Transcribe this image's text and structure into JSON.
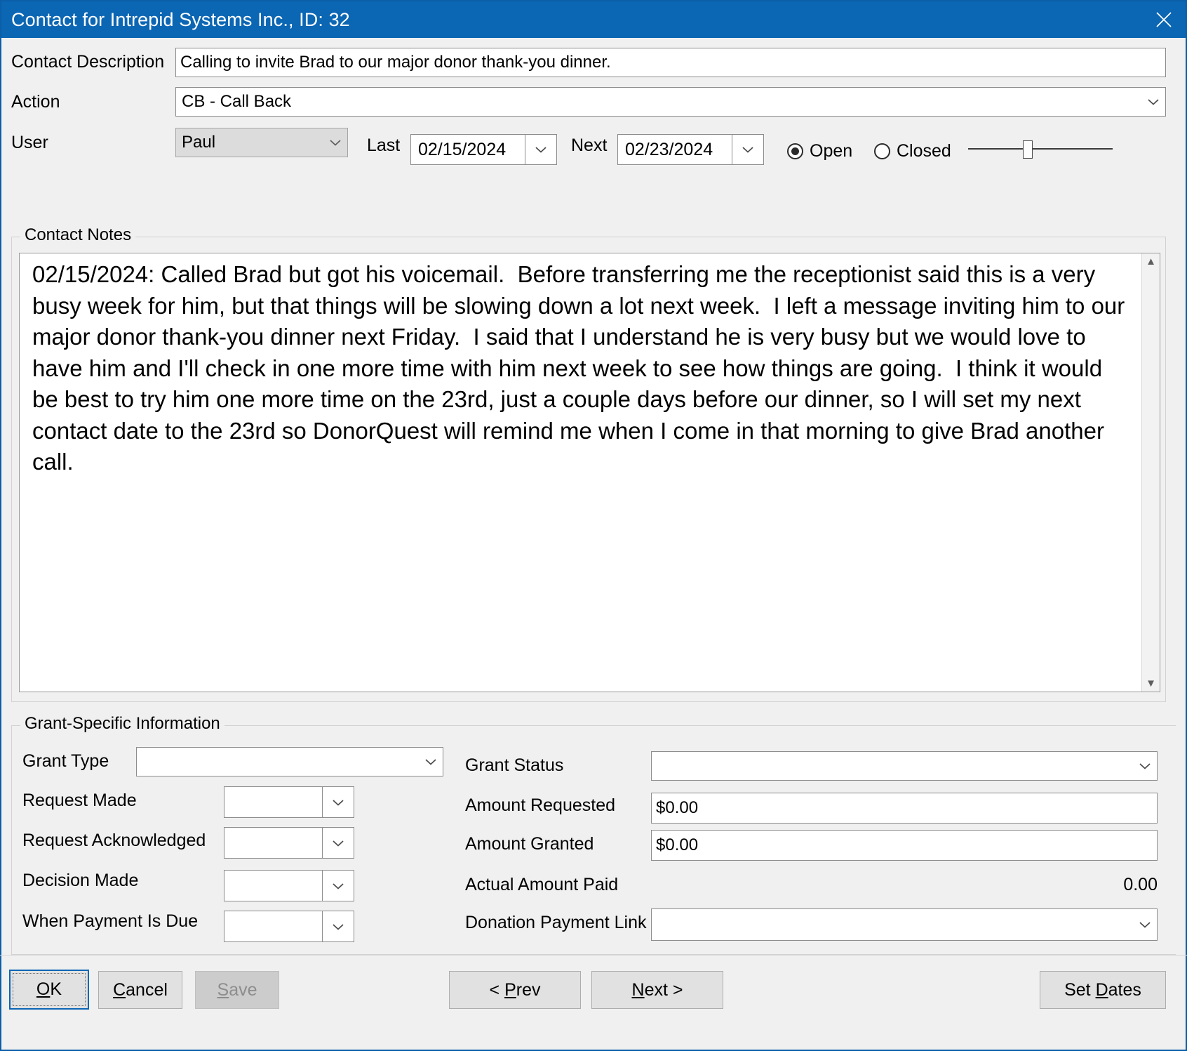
{
  "window": {
    "title": "Contact for Intrepid Systems Inc., ID: 32",
    "close_label": "✕",
    "accent_color": "#0b66b4"
  },
  "form": {
    "contact_description": {
      "label": "Contact Description",
      "value": "Calling to invite Brad to our major donor thank-you dinner.",
      "placeholder": ""
    },
    "action": {
      "label": "Action",
      "value": "CB - Call Back"
    },
    "user": {
      "label": "User",
      "value": "Paul"
    },
    "last": {
      "label": "Last",
      "value": "02/15/2024"
    },
    "next": {
      "label": "Next",
      "value": "02/23/2024"
    },
    "status": {
      "open_label": "Open",
      "closed_label": "Closed",
      "selected": "Open"
    }
  },
  "notes": {
    "legend": "Contact Notes",
    "value": "02/15/2024: Called Brad but got his voicemail.  Before transferring me the receptionist said this is a very busy week for him, but that things will be slowing down a lot next week.  I left a message inviting him to our major donor thank-you dinner next Friday.  I said that I understand he is very busy but we would love to have him and I'll check in one more time with him next week to see how things are going.  I think it would be best to try him one more time on the 23rd, just a couple days before our dinner, so I will set my next contact date to the 23rd so DonorQuest will remind me when I come in that morning to give Brad another call."
  },
  "grant": {
    "legend": "Grant-Specific Information",
    "grant_type": {
      "label": "Grant Type",
      "value": ""
    },
    "request_made": {
      "label": "Request Made",
      "value": ""
    },
    "request_acknowledged": {
      "label": "Request Acknowledged",
      "value": ""
    },
    "decision_made": {
      "label": "Decision Made",
      "value": ""
    },
    "when_payment_due": {
      "label": "When Payment Is Due",
      "value": ""
    },
    "grant_status": {
      "label": "Grant Status",
      "value": ""
    },
    "amount_requested": {
      "label": "Amount Requested",
      "value": "$0.00"
    },
    "amount_granted": {
      "label": "Amount Granted",
      "value": "$0.00"
    },
    "actual_amount_paid": {
      "label": "Actual Amount Paid",
      "value": "0.00"
    },
    "donation_payment_link": {
      "label": "Donation Payment Link",
      "value": ""
    }
  },
  "buttons": {
    "ok": "OK",
    "cancel": "Cancel",
    "save": "Save",
    "prev": "< Prev",
    "next": "Next >",
    "set_dates": "Set Dates"
  }
}
